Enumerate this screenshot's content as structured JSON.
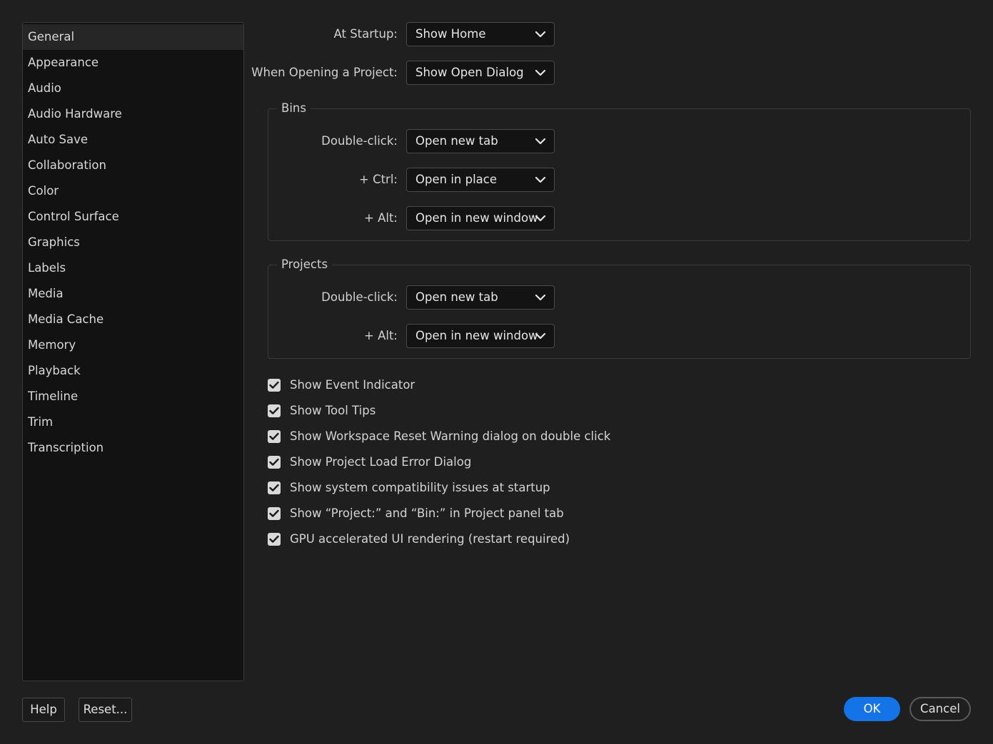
{
  "sidebar": {
    "items": [
      {
        "label": "General"
      },
      {
        "label": "Appearance"
      },
      {
        "label": "Audio"
      },
      {
        "label": "Audio Hardware"
      },
      {
        "label": "Auto Save"
      },
      {
        "label": "Collaboration"
      },
      {
        "label": "Color"
      },
      {
        "label": "Control Surface"
      },
      {
        "label": "Graphics"
      },
      {
        "label": "Labels"
      },
      {
        "label": "Media"
      },
      {
        "label": "Media Cache"
      },
      {
        "label": "Memory"
      },
      {
        "label": "Playback"
      },
      {
        "label": "Timeline"
      },
      {
        "label": "Trim"
      },
      {
        "label": "Transcription"
      }
    ],
    "selected": "General"
  },
  "general": {
    "at_startup": {
      "label": "At Startup:",
      "value": "Show Home"
    },
    "when_opening": {
      "label": "When Opening a Project:",
      "value": "Show Open Dialog"
    }
  },
  "bins": {
    "title": "Bins",
    "double_click": {
      "label": "Double-click:",
      "value": "Open new tab"
    },
    "ctrl": {
      "label": "+ Ctrl:",
      "value": "Open in place"
    },
    "alt": {
      "label": "+ Alt:",
      "value": "Open in new window"
    }
  },
  "projects": {
    "title": "Projects",
    "double_click": {
      "label": "Double-click:",
      "value": "Open new tab"
    },
    "alt": {
      "label": "+ Alt:",
      "value": "Open in new window"
    }
  },
  "options": [
    {
      "label": "Show Event Indicator",
      "checked": true
    },
    {
      "label": "Show Tool Tips",
      "checked": true
    },
    {
      "label": "Show Workspace Reset Warning dialog on double click",
      "checked": true
    },
    {
      "label": "Show Project Load Error Dialog",
      "checked": true
    },
    {
      "label": "Show system compatibility issues at startup",
      "checked": true
    },
    {
      "label": "Show “Project:” and “Bin:” in Project panel tab",
      "checked": true
    },
    {
      "label": "GPU accelerated UI rendering (restart required)",
      "checked": true
    }
  ],
  "footer": {
    "help": "Help",
    "reset": "Reset...",
    "ok": "OK",
    "cancel": "Cancel"
  },
  "icons": {
    "dropdown": "chevron-down-icon",
    "check": "checkmark-icon"
  },
  "colors": {
    "accent": "#1473e6",
    "background": "#1f1f1f",
    "sidebar_bg": "#121212"
  }
}
